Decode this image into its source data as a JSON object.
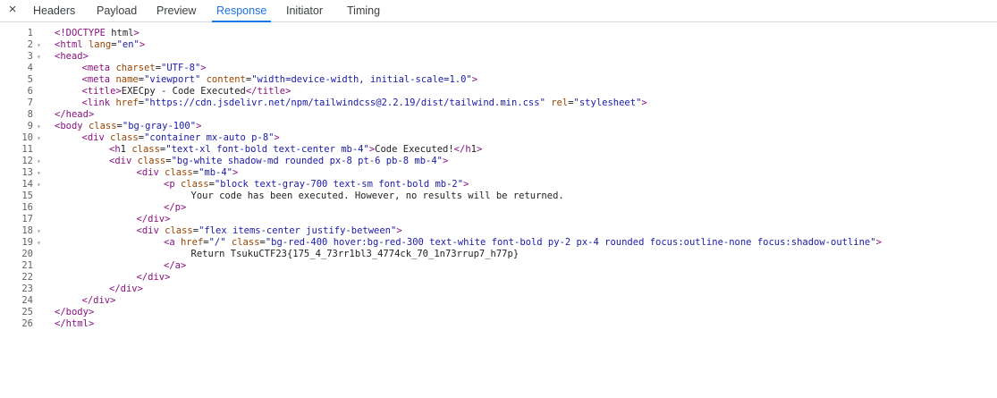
{
  "tabs": [
    {
      "label": "Headers",
      "active": false
    },
    {
      "label": "Payload",
      "active": false
    },
    {
      "label": "Preview",
      "active": false
    },
    {
      "label": "Response",
      "active": true
    },
    {
      "label": "Initiator",
      "active": false
    },
    {
      "label": "Timing",
      "active": false
    }
  ],
  "close_icon": "×",
  "colors": {
    "accent": "#1a73e8",
    "tag": "#881280",
    "attribute": "#994500",
    "value": "#1a1aa6",
    "text": "#1f1f1f",
    "line_number": "#5f6368"
  },
  "code_lines": [
    {
      "n": "1",
      "indent": 0,
      "fold": false,
      "text": "<!DOCTYPE html>"
    },
    {
      "n": "2",
      "indent": 0,
      "fold": true,
      "text": "<html lang=\"en\">"
    },
    {
      "n": "3",
      "indent": 0,
      "fold": true,
      "text": "<head>"
    },
    {
      "n": "4",
      "indent": 1,
      "fold": false,
      "text": "<meta charset=\"UTF-8\">"
    },
    {
      "n": "5",
      "indent": 1,
      "fold": false,
      "text": "<meta name=\"viewport\" content=\"width=device-width, initial-scale=1.0\">"
    },
    {
      "n": "6",
      "indent": 1,
      "fold": false,
      "text": "<title>EXECpy - Code Executed</title>"
    },
    {
      "n": "7",
      "indent": 1,
      "fold": false,
      "text": "<link href=\"https://cdn.jsdelivr.net/npm/tailwindcss@2.2.19/dist/tailwind.min.css\" rel=\"stylesheet\">"
    },
    {
      "n": "8",
      "indent": 0,
      "fold": false,
      "text": "</head>"
    },
    {
      "n": "9",
      "indent": 0,
      "fold": true,
      "text": "<body class=\"bg-gray-100\">"
    },
    {
      "n": "10",
      "indent": 1,
      "fold": true,
      "text": "<div class=\"container mx-auto p-8\">"
    },
    {
      "n": "11",
      "indent": 2,
      "fold": false,
      "text": "<h1 class=\"text-xl font-bold text-center mb-4\">Code Executed!</h1>"
    },
    {
      "n": "12",
      "indent": 2,
      "fold": true,
      "text": "<div class=\"bg-white shadow-md rounded px-8 pt-6 pb-8 mb-4\">"
    },
    {
      "n": "13",
      "indent": 3,
      "fold": true,
      "text": "<div class=\"mb-4\">"
    },
    {
      "n": "14",
      "indent": 4,
      "fold": true,
      "text": "<p class=\"block text-gray-700 text-sm font-bold mb-2\">"
    },
    {
      "n": "15",
      "indent": 5,
      "fold": false,
      "text": "Your code has been executed. However, no results will be returned."
    },
    {
      "n": "16",
      "indent": 4,
      "fold": false,
      "text": "</p>"
    },
    {
      "n": "17",
      "indent": 3,
      "fold": false,
      "text": "</div>"
    },
    {
      "n": "18",
      "indent": 3,
      "fold": true,
      "text": "<div class=\"flex items-center justify-between\">"
    },
    {
      "n": "19",
      "indent": 4,
      "fold": true,
      "text": "<a href=\"/\" class=\"bg-red-400 hover:bg-red-300 text-white font-bold py-2 px-4 rounded focus:outline-none focus:shadow-outline\">"
    },
    {
      "n": "20",
      "indent": 5,
      "fold": false,
      "text": "Return TsukuCTF23{175_4_73rr1bl3_4774ck_70_1n73rrup7_h77p}"
    },
    {
      "n": "21",
      "indent": 4,
      "fold": false,
      "text": "</a>"
    },
    {
      "n": "22",
      "indent": 3,
      "fold": false,
      "text": "</div>"
    },
    {
      "n": "23",
      "indent": 2,
      "fold": false,
      "text": "</div>"
    },
    {
      "n": "24",
      "indent": 1,
      "fold": false,
      "text": "</div>"
    },
    {
      "n": "25",
      "indent": 0,
      "fold": false,
      "text": "</body>"
    },
    {
      "n": "26",
      "indent": 0,
      "fold": false,
      "text": "</html>"
    }
  ]
}
